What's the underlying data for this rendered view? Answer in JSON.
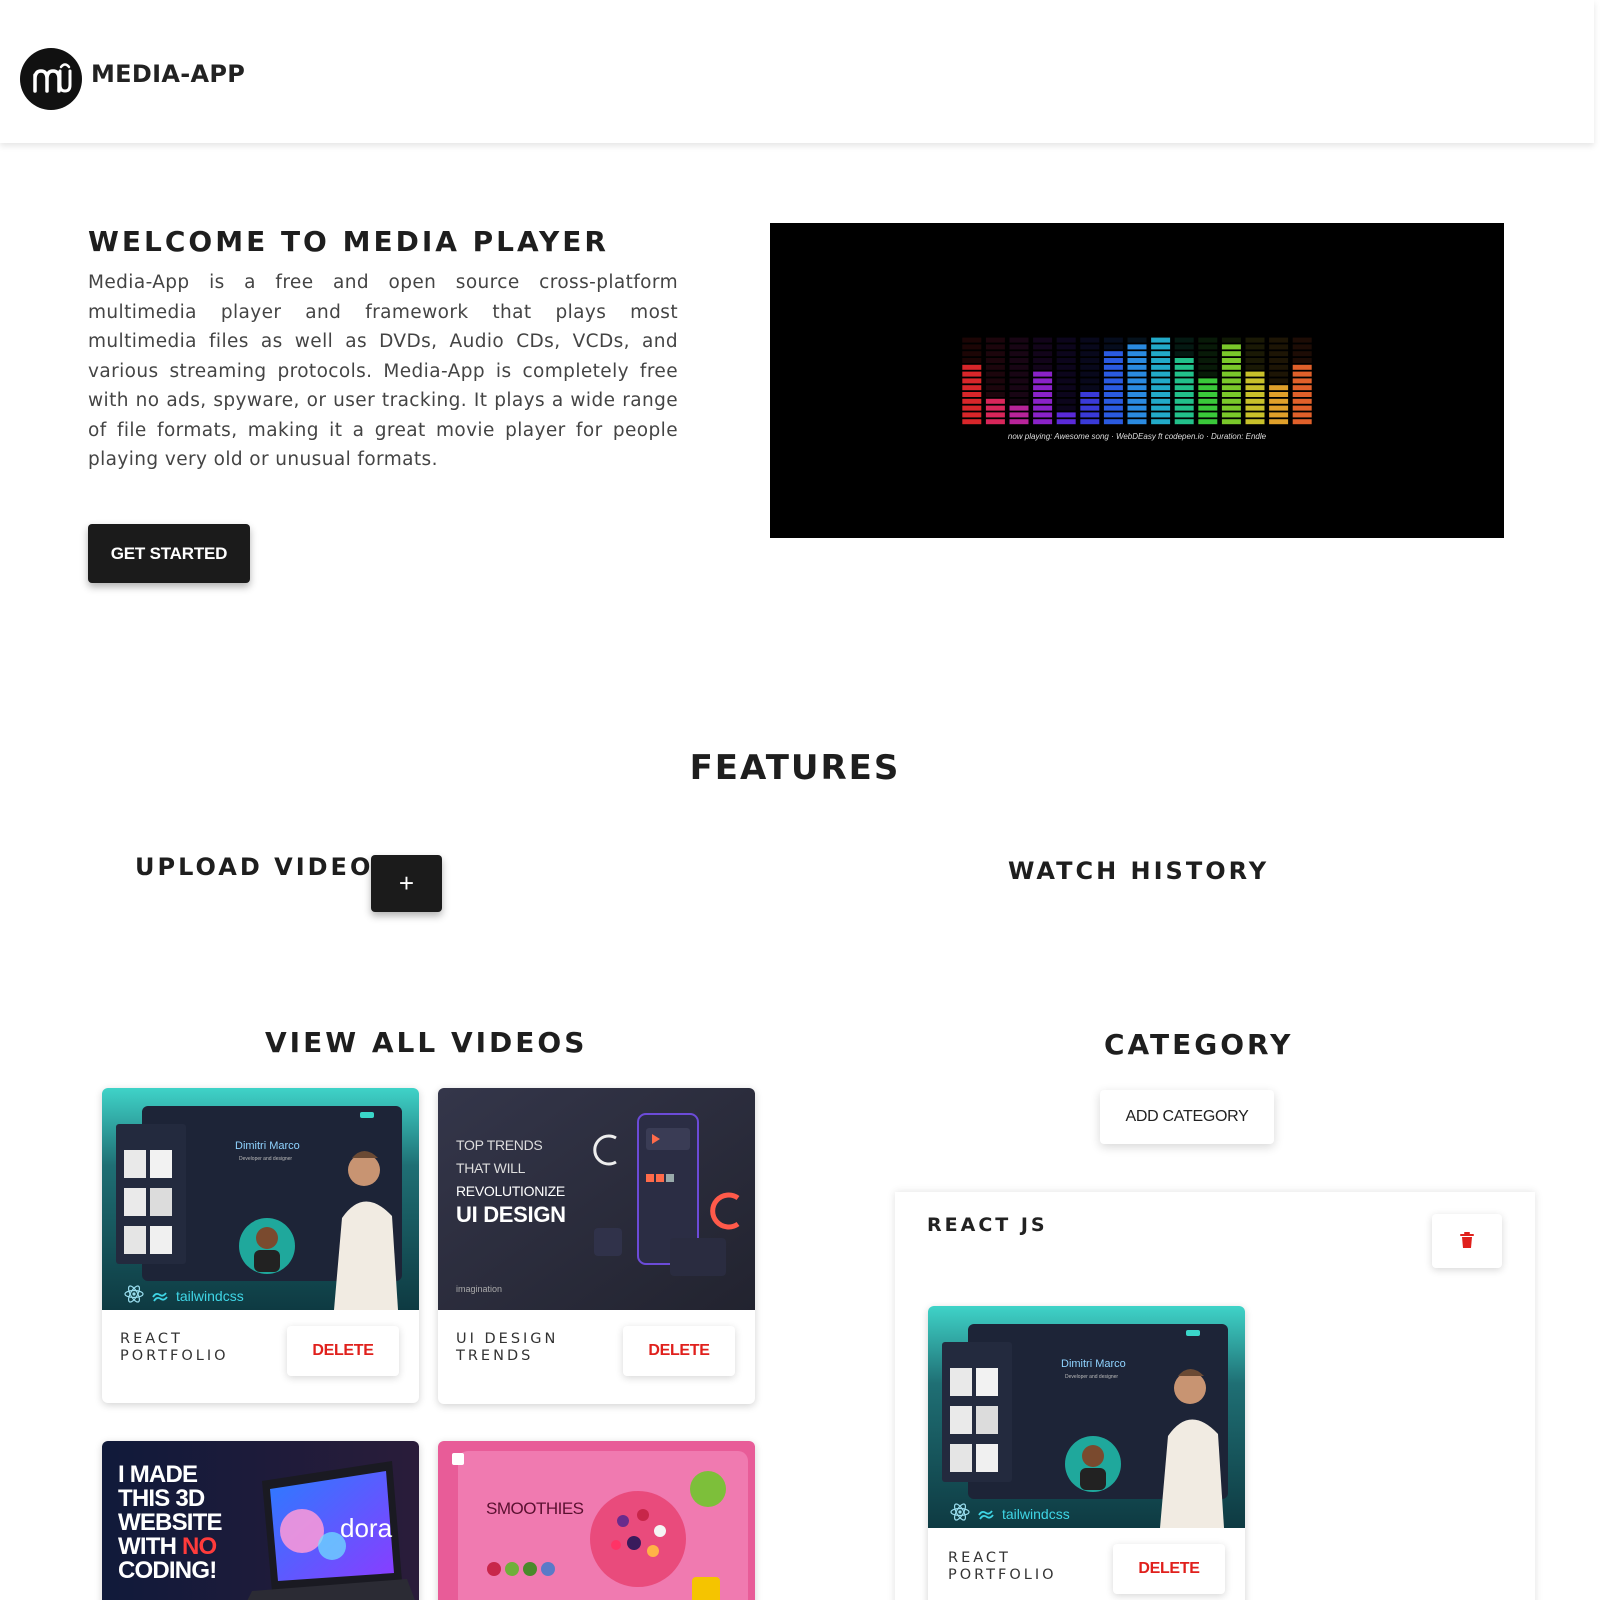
{
  "app": {
    "brand": "MEDIA-APP"
  },
  "hero": {
    "title": "WELCOME TO MEDIA PLAYER",
    "description": "Media-App is a free and open source cross-platform multimedia player and framework that plays most multimedia files as well as DVDs, Audio CDs, VCDs, and various streaming protocols. Media-App is completely free with no ads, spyware, or user tracking. It plays a wide range of file formats, making it a great movie player for people playing very old or unusual formats.",
    "cta_label": "GET STARTED",
    "visualizer_caption": "now playing: Awesome song · WebDEasy ft codepen.io · Duration: Endle"
  },
  "features": {
    "title": "FEATURES",
    "upload_title": "UPLOAD VIDEO",
    "upload_button": "+",
    "history_title": "WATCH HISTORY"
  },
  "videos": {
    "title": "VIEW ALL VIDEOS",
    "delete_label": "DELETE",
    "items": [
      {
        "title": "REACT PORTFOLIO",
        "thumb": {
          "name": "Dimitri Marco",
          "sub": "Developer and designer",
          "brand": "tailwindcss"
        }
      },
      {
        "title": "UI DESIGN TRENDS",
        "thumb": {
          "l1": "TOP TRENDS",
          "l2": "THAT WILL",
          "l3": "REVOLUTIONIZE",
          "l4": "UI DESIGN",
          "brand": "imagination"
        }
      },
      {
        "title": "",
        "thumb": {
          "l1": "I MADE",
          "l2": "THIS 3D",
          "l3": "WEBSITE",
          "l4a": "WITH ",
          "l4b": "NO",
          "l5": "CODING!",
          "screen": "dora"
        }
      },
      {
        "title": "",
        "thumb": {
          "word": "SMOOTHIES"
        }
      }
    ]
  },
  "category": {
    "title": "CATEGORY",
    "add_label": "ADD CATEGORY",
    "items": [
      {
        "name": "REACT JS",
        "video": {
          "title": "REACT PORTFOLIO",
          "delete_label": "DELETE",
          "thumb": {
            "name": "Dimitri Marco",
            "sub": "Developer and designer",
            "brand": "tailwindcss"
          }
        }
      }
    ]
  },
  "visualizer_levels": [
    9,
    4,
    3,
    8,
    2,
    5,
    11,
    12,
    13,
    10,
    7,
    12,
    8,
    6,
    9
  ],
  "visualizer_max": 13,
  "colors": {
    "accent_dark": "#1b1b1b",
    "delete_red": "#e0201c",
    "visualizer_bg": "#000000"
  }
}
